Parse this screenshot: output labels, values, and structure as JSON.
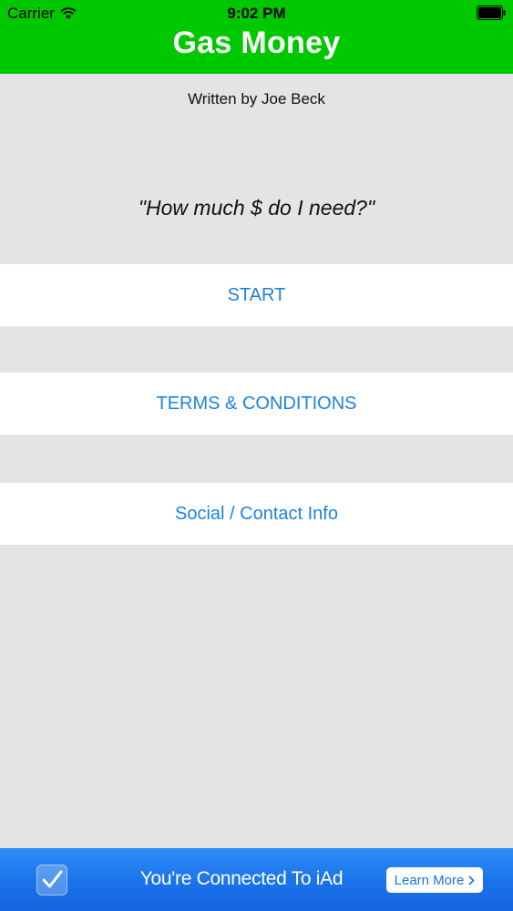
{
  "status_bar": {
    "carrier": "Carrier",
    "time": "9:02 PM"
  },
  "header": {
    "title": "Gas Money",
    "color": "#00c800"
  },
  "main": {
    "author": "Written by Joe Beck",
    "tagline": "\"How much $ do I need?\"",
    "buttons": [
      {
        "label": "START"
      },
      {
        "label": "TERMS & CONDITIONS"
      },
      {
        "label": "Social / Contact Info"
      }
    ]
  },
  "ad": {
    "text": "You're Connected To iAd",
    "button_label": "Learn More",
    "icon": "checkmark-icon",
    "color": "#1a72ea"
  },
  "colors": {
    "background": "#e4e4e6",
    "accent": "#1a82e2"
  }
}
